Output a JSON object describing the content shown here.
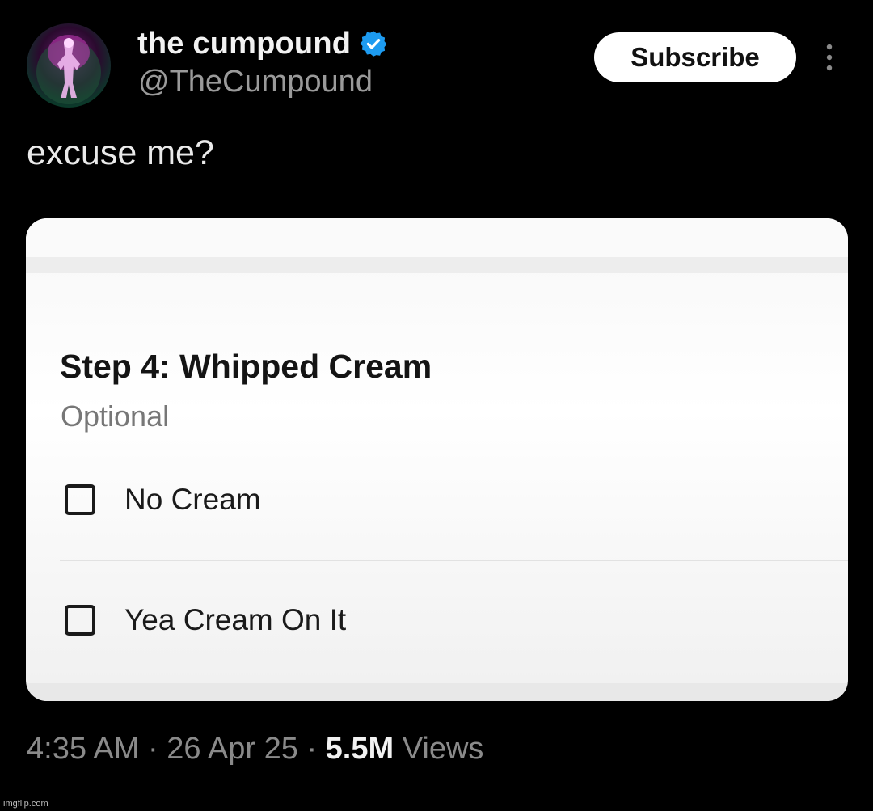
{
  "author": {
    "display_name": "the cumpound",
    "handle": "@TheCumpound",
    "verified": true,
    "verified_color": "#1d9bf0"
  },
  "actions": {
    "subscribe_label": "Subscribe",
    "more_icon": "more-vertical-icon"
  },
  "tweet": {
    "text": "excuse me?"
  },
  "card": {
    "step_title": "Step 4: Whipped Cream",
    "step_subtitle": "Optional",
    "options": [
      {
        "label": "No Cream",
        "checked": false
      },
      {
        "label": "Yea Cream On It",
        "checked": false
      }
    ]
  },
  "meta": {
    "time": "4:35 AM",
    "date": "26 Apr 25",
    "views_count": "5.5M",
    "views_label": "Views",
    "separator": "·"
  },
  "watermark": "imgflip.com"
}
